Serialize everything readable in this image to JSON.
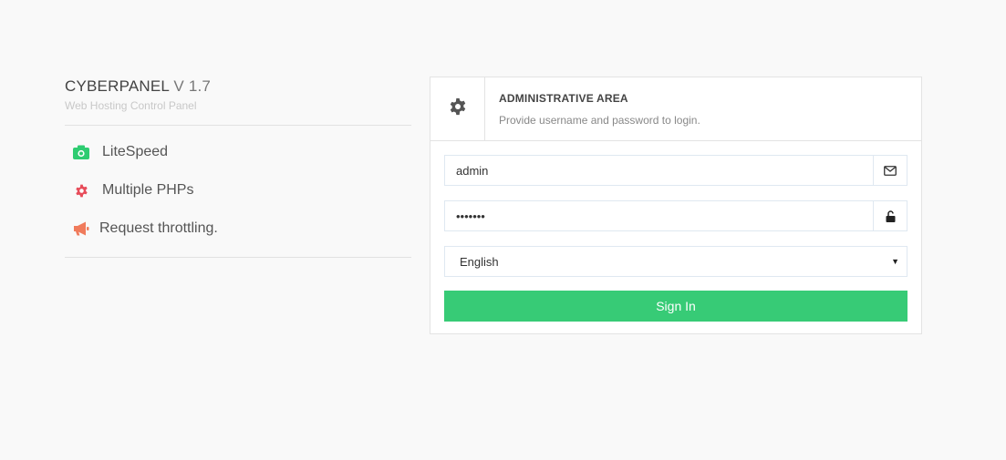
{
  "brand": {
    "name": "CYBERPANEL",
    "version": "V 1.7",
    "tagline": "Web Hosting Control Panel"
  },
  "features": [
    {
      "label": "LiteSpeed",
      "icon": "camera-icon",
      "color": "#2ecc71"
    },
    {
      "label": "Multiple PHPs",
      "icon": "gear-icon",
      "color": "#e74c5a"
    },
    {
      "label": "Request throttling.",
      "icon": "megaphone-icon",
      "color": "#f07b5c"
    }
  ],
  "login": {
    "title": "ADMINISTRATIVE AREA",
    "subtitle": "Provide username and password to login.",
    "header_icon": "gear-icon",
    "username": {
      "value": "admin",
      "icon": "envelope-icon"
    },
    "password": {
      "value": "•••••••",
      "icon": "unlock-icon"
    },
    "language": {
      "selected": "English"
    },
    "signin_label": "Sign In",
    "accent_color": "#37cb76"
  }
}
